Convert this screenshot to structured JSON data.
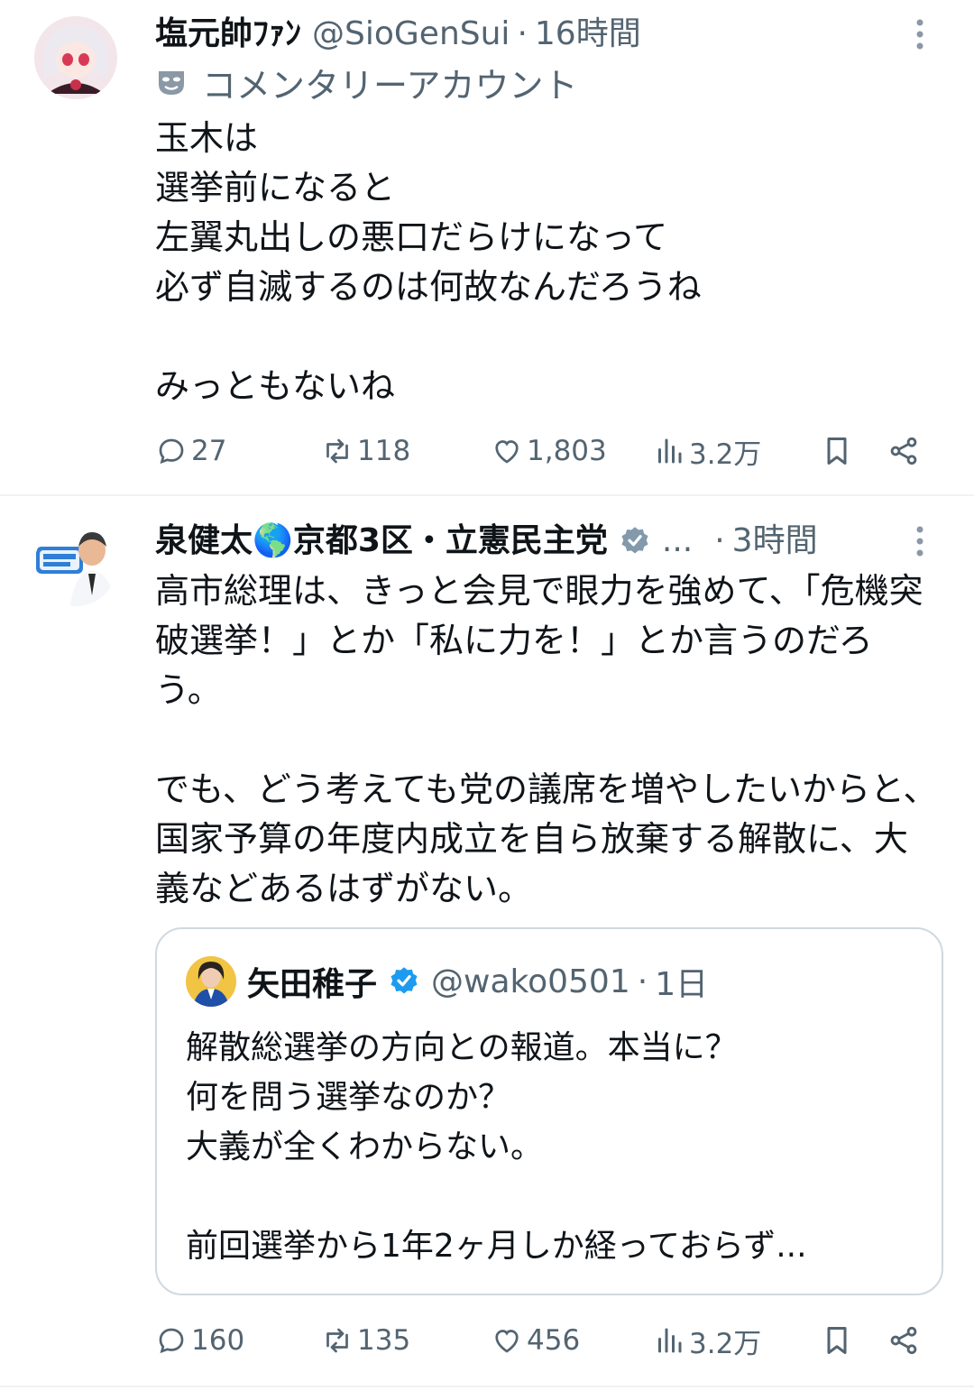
{
  "tweets": [
    {
      "display_name": "塩元帥ﾌｧﾝ",
      "handle": "@SioGenSui",
      "time": "16時間",
      "label": "コメンタリーアカウント",
      "text": "玉木は\n選挙前になると\n左翼丸出しの悪口だらけになって\n必ず自滅するのは何故なんだろうね\n\nみっともないね",
      "stats": {
        "replies": "27",
        "reposts": "118",
        "likes": "1,803",
        "views": "3.2万"
      }
    },
    {
      "display_name": "泉健太🌎京都3区・立憲民主党",
      "ellipsis": "...",
      "time": "3時間",
      "text": "高市総理は、きっと会見で眼力を強めて、「危機突破選挙！」とか「私に力を！」とか言うのだろう。\n\nでも、どう考えても党の議席を増やしたいからと、国家予算の年度内成立を自ら放棄する解散に、大義などあるはずがない。",
      "quote": {
        "display_name": "矢田稚子",
        "handle": "@wako0501",
        "time": "1日",
        "text": "解散総選挙の方向との報道。本当に？\n何を問う選挙なのか？\n大義が全くわからない。\n\n前回選挙から1年2ヶ月しか経っておらず..."
      },
      "stats": {
        "replies": "160",
        "reposts": "135",
        "likes": "456",
        "views": "3.2万"
      }
    }
  ],
  "colors": {
    "text": "#0f1419",
    "muted": "#536471",
    "verified": "#1d9bf0",
    "border": "#cfd9de"
  }
}
